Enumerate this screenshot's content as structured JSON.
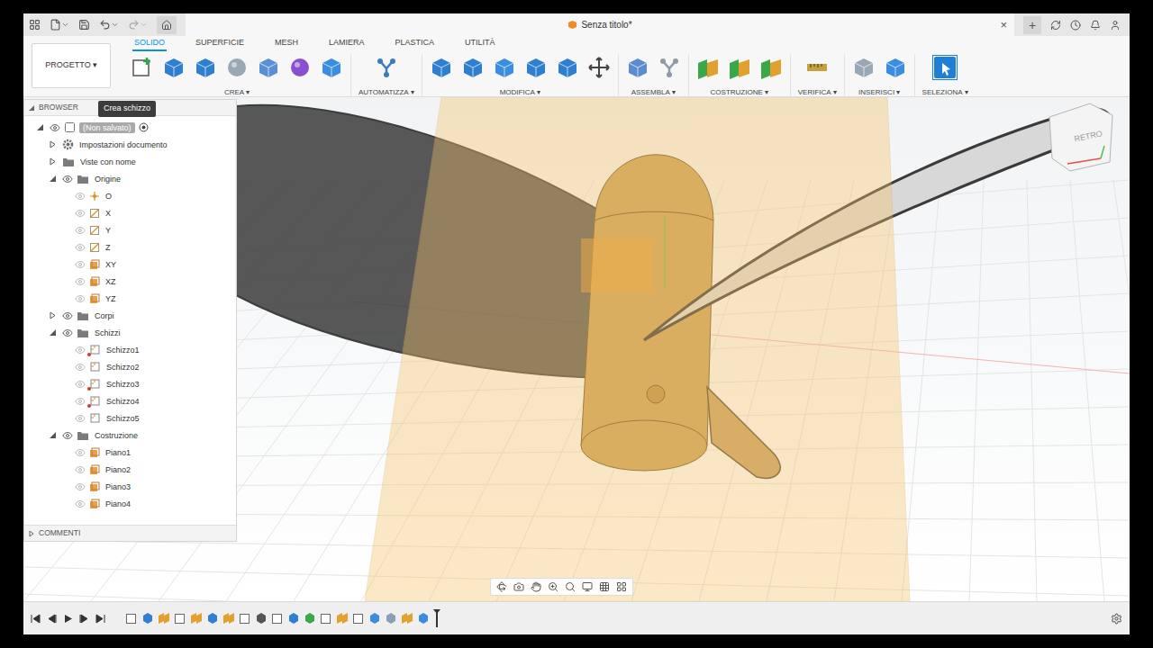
{
  "window": {
    "title": "Senza titolo*",
    "close": "×",
    "new_tab": "+"
  },
  "toolbar": {
    "workspace": "PROGETTO",
    "arrow": "▾",
    "tabs": [
      {
        "label": "SOLIDO",
        "selected": true
      },
      {
        "label": "SUPERFICIE",
        "selected": false
      },
      {
        "label": "MESH",
        "selected": false
      },
      {
        "label": "LAMIERA",
        "selected": false
      },
      {
        "label": "PLASTICA",
        "selected": false
      },
      {
        "label": "UTILITÀ",
        "selected": false
      }
    ],
    "groups": [
      {
        "label": "CREA",
        "active": false,
        "icons": [
          "sketch",
          "extrude",
          "revolve",
          "hole",
          "rib",
          "form",
          "shell"
        ]
      },
      {
        "label": "AUTOMATIZZA",
        "active": false,
        "icons": [
          "automate"
        ]
      },
      {
        "label": "MODIFICA",
        "active": false,
        "icons": [
          "press",
          "fillet",
          "shellbox",
          "combine",
          "layers",
          "move"
        ]
      },
      {
        "label": "ASSEMBLA",
        "active": false,
        "icons": [
          "component",
          "joint"
        ]
      },
      {
        "label": "COSTRUZIONE",
        "active": false,
        "icons": [
          "offset-plane",
          "angle-plane",
          "midplane"
        ]
      },
      {
        "label": "VERIFICA",
        "active": false,
        "icons": [
          "measure"
        ]
      },
      {
        "label": "INSERISCI",
        "active": false,
        "icons": [
          "insert",
          "image"
        ]
      },
      {
        "label": "SELEZIONA",
        "active": true,
        "icons": [
          "select"
        ]
      }
    ]
  },
  "browser": {
    "title": "BROWSER",
    "tooltip": "Crea schizzo",
    "comments": "COMMENTI",
    "items": [
      {
        "label": "(Non salvato)",
        "depth": 0,
        "has_children": true,
        "expanded": true,
        "has_eye": true,
        "visible": true,
        "kind": "component",
        "selected": true,
        "locked": false
      },
      {
        "label": "Impostazioni documento",
        "depth": 1,
        "has_children": true,
        "expanded": false,
        "has_eye": false,
        "visible": true,
        "kind": "gear",
        "selected": false,
        "locked": false
      },
      {
        "label": "Viste con nome",
        "depth": 1,
        "has_children": true,
        "expanded": false,
        "has_eye": false,
        "visible": true,
        "kind": "folder",
        "selected": false,
        "locked": false
      },
      {
        "label": "Origine",
        "depth": 1,
        "has_children": true,
        "expanded": true,
        "has_eye": true,
        "visible": true,
        "kind": "folder",
        "selected": false,
        "locked": false
      },
      {
        "label": "O",
        "depth": 2,
        "has_children": false,
        "expanded": false,
        "has_eye": true,
        "visible": false,
        "kind": "point",
        "selected": false,
        "locked": false
      },
      {
        "label": "X",
        "depth": 2,
        "has_children": false,
        "expanded": false,
        "has_eye": true,
        "visible": false,
        "kind": "axis",
        "selected": false,
        "locked": false
      },
      {
        "label": "Y",
        "depth": 2,
        "has_children": false,
        "expanded": false,
        "has_eye": true,
        "visible": false,
        "kind": "axis",
        "selected": false,
        "locked": false
      },
      {
        "label": "Z",
        "depth": 2,
        "has_children": false,
        "expanded": false,
        "has_eye": true,
        "visible": false,
        "kind": "axis",
        "selected": false,
        "locked": false
      },
      {
        "label": "XY",
        "depth": 2,
        "has_children": false,
        "expanded": false,
        "has_eye": true,
        "visible": false,
        "kind": "plane",
        "selected": false,
        "locked": false
      },
      {
        "label": "XZ",
        "depth": 2,
        "has_children": false,
        "expanded": false,
        "has_eye": true,
        "visible": false,
        "kind": "plane",
        "selected": false,
        "locked": false
      },
      {
        "label": "YZ",
        "depth": 2,
        "has_children": false,
        "expanded": false,
        "has_eye": true,
        "visible": false,
        "kind": "plane",
        "selected": false,
        "locked": false
      },
      {
        "label": "Corpi",
        "depth": 1,
        "has_children": true,
        "expanded": false,
        "has_eye": true,
        "visible": true,
        "kind": "folder",
        "selected": false,
        "locked": false
      },
      {
        "label": "Schizzi",
        "depth": 1,
        "has_children": true,
        "expanded": true,
        "has_eye": true,
        "visible": true,
        "kind": "folder",
        "selected": false,
        "locked": false
      },
      {
        "label": "Schizzo1",
        "depth": 2,
        "has_children": false,
        "expanded": false,
        "has_eye": true,
        "visible": false,
        "kind": "sketch",
        "selected": false,
        "locked": true
      },
      {
        "label": "Schizzo2",
        "depth": 2,
        "has_children": false,
        "expanded": false,
        "has_eye": true,
        "visible": false,
        "kind": "sketch",
        "selected": false,
        "locked": false
      },
      {
        "label": "Schizzo3",
        "depth": 2,
        "has_children": false,
        "expanded": false,
        "has_eye": true,
        "visible": false,
        "kind": "sketch",
        "selected": false,
        "locked": true
      },
      {
        "label": "Schizzo4",
        "depth": 2,
        "has_children": false,
        "expanded": false,
        "has_eye": true,
        "visible": false,
        "kind": "sketch",
        "selected": false,
        "locked": true
      },
      {
        "label": "Schizzo5",
        "depth": 2,
        "has_children": false,
        "expanded": false,
        "has_eye": true,
        "visible": false,
        "kind": "sketch",
        "selected": false,
        "locked": false
      },
      {
        "label": "Costruzione",
        "depth": 1,
        "has_children": true,
        "expanded": true,
        "has_eye": true,
        "visible": true,
        "kind": "folder",
        "selected": false,
        "locked": false
      },
      {
        "label": "Piano1",
        "depth": 2,
        "has_children": false,
        "expanded": false,
        "has_eye": true,
        "visible": false,
        "kind": "plane",
        "selected": false,
        "locked": false
      },
      {
        "label": "Piano2",
        "depth": 2,
        "has_children": false,
        "expanded": false,
        "has_eye": true,
        "visible": false,
        "kind": "plane",
        "selected": false,
        "locked": false
      },
      {
        "label": "Piano3",
        "depth": 2,
        "has_children": false,
        "expanded": false,
        "has_eye": true,
        "visible": false,
        "kind": "plane",
        "selected": false,
        "locked": false
      },
      {
        "label": "Piano4",
        "depth": 2,
        "has_children": false,
        "expanded": false,
        "has_eye": true,
        "visible": false,
        "kind": "plane",
        "selected": false,
        "locked": false
      }
    ]
  },
  "viewcube": {
    "label": "RETRO"
  },
  "timeline": {
    "features": [
      "sketch",
      "extrude",
      "plane",
      "sketch",
      "plane",
      "revolve",
      "plane",
      "sketch",
      "move",
      "sketch",
      "fillet",
      "pattern",
      "sketch",
      "plane",
      "sketch",
      "loft",
      "combine",
      "plane",
      "loft"
    ]
  }
}
